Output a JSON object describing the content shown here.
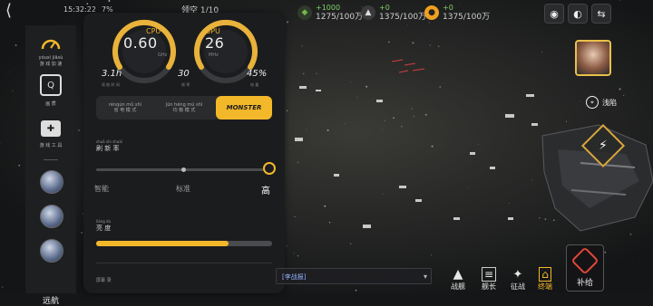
{
  "statusbar": {
    "time": "15:32:22",
    "battery": "7%",
    "zoom_level": "领空 1/10"
  },
  "resources": [
    {
      "gain": "+1000",
      "amount": "1275/100万",
      "color": "#6fb64a",
      "icon": "crystal-icon"
    },
    {
      "gain": "+0",
      "amount": "1375/100万",
      "color": "#d8d8d8",
      "icon": "metal-icon"
    },
    {
      "gain": "+0",
      "amount": "1375/100万",
      "color": "#f0a020",
      "icon": "energy-icon"
    }
  ],
  "assistant": {
    "rail_title_pinyin": "yóuxì jiāsù",
    "rail_title": "游 戏 加 速",
    "rail_caption_2": "画 质",
    "rail_caption_3": "游 戏 工 具",
    "cpu": {
      "label": "CPU",
      "value": "0.60",
      "unit": "GHz"
    },
    "gpu": {
      "label": "GPU",
      "value": "26",
      "unit": "MHz"
    },
    "stats": {
      "time": "3.1h",
      "fps": "30",
      "battery": "45%",
      "time_sub": "续 航 时 间",
      "fps_sub": "帧 率",
      "battery_sub": "电 量"
    },
    "modes": [
      {
        "pinyin": "rénqún mǔ shì",
        "label": "省 电 模 式",
        "active": false
      },
      {
        "pinyin": "jūn héng mú shì",
        "label": "均 衡 模 式",
        "active": false
      },
      {
        "label": "MONSTER",
        "active": true
      }
    ],
    "perf": {
      "pinyin": "shuā xīn shuài",
      "title": "刷 新 率",
      "options": [
        "智能",
        "标准",
        "高"
      ],
      "selected": 2
    },
    "brightness": {
      "pinyin": "liàng dù",
      "title": "亮 度",
      "level": 0.75
    },
    "truncated_label": "屏幕 录"
  },
  "hud": {
    "target_label": "浅陷",
    "chat_text": "[李战报]",
    "supply_label": "补给",
    "bottom_buttons": [
      {
        "label": "战舰",
        "icon": "ship-icon"
      },
      {
        "label": "舰长",
        "icon": "captain-icon"
      },
      {
        "label": "征战",
        "icon": "conquest-icon"
      },
      {
        "label": "终端",
        "icon": "terminal-icon"
      }
    ],
    "left_label": "远航"
  }
}
